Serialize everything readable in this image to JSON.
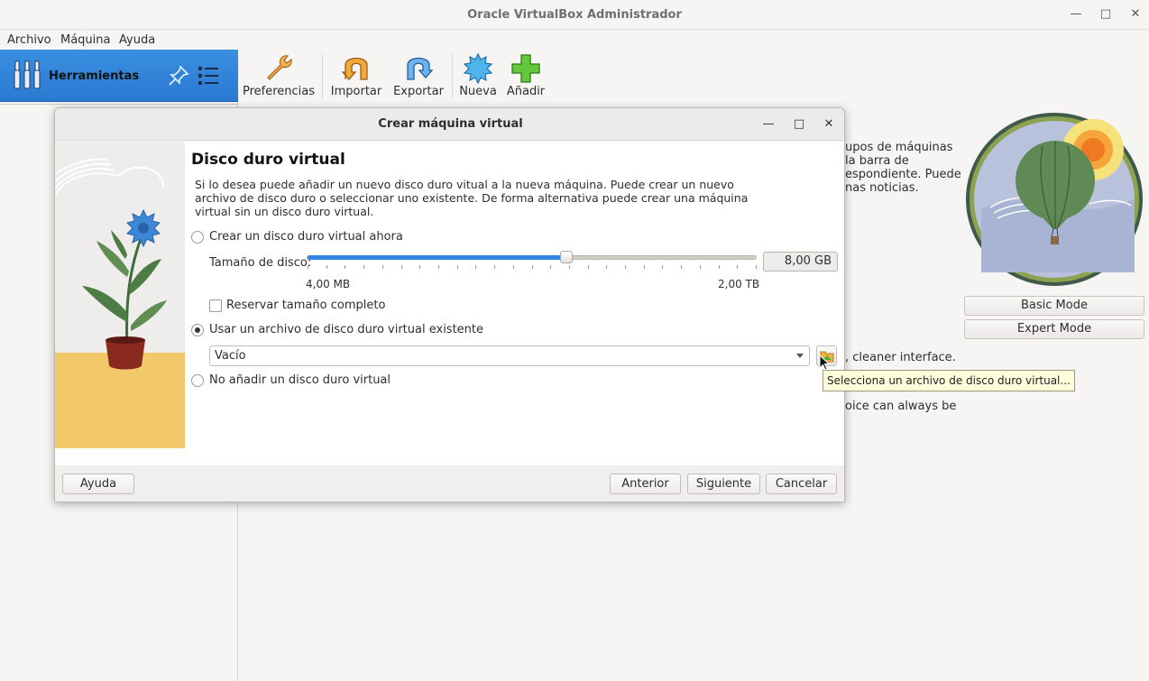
{
  "window": {
    "title": "Oracle VirtualBox Administrador"
  },
  "menu": [
    {
      "label": "Archivo"
    },
    {
      "label": "Máquina"
    },
    {
      "label": "Ayuda"
    }
  ],
  "tools": {
    "label": "Herramientas"
  },
  "toolbar": {
    "preferencias": "Preferencias",
    "importar": "Importar",
    "exportar": "Exportar",
    "nueva": "Nueva",
    "anadir": "Añadir"
  },
  "background": {
    "line1": "upos de máquinas",
    "line2": "la barra de",
    "line3": "espondiente. Puede",
    "line4": "nas noticias.",
    "line5": ", cleaner interface.",
    "line6": "oice can always be",
    "basic_mode": "Basic Mode",
    "expert_mode": "Expert Mode"
  },
  "dialog": {
    "title": "Crear máquina virtual",
    "heading": "Disco duro virtual",
    "description": "Si lo desea puede añadir un nuevo disco duro vitual a la nueva máquina. Puede crear un nuevo archivo de disco duro o seleccionar uno existente. De forma alternativa puede crear una máquina virtual sin un disco duro virtual.",
    "option_create": "Crear un disco duro virtual ahora",
    "disk_size_label": "Tamaño de disco:",
    "disk_size_value": "8,00 GB",
    "slider_min": "4,00 MB",
    "slider_max": "2,00 TB",
    "slider_fraction": 0.577,
    "reserve_label": "Reservar tamaño completo",
    "option_existing": "Usar un archivo de disco duro virtual existente",
    "existing_value": "Vacío",
    "option_none": "No añadir un disco duro virtual",
    "btn_help": "Ayuda",
    "btn_back": "Anterior",
    "btn_next": "Siguiente",
    "btn_cancel": "Cancelar"
  },
  "tooltip": "Selecciona un archivo de disco duro virtual..."
}
